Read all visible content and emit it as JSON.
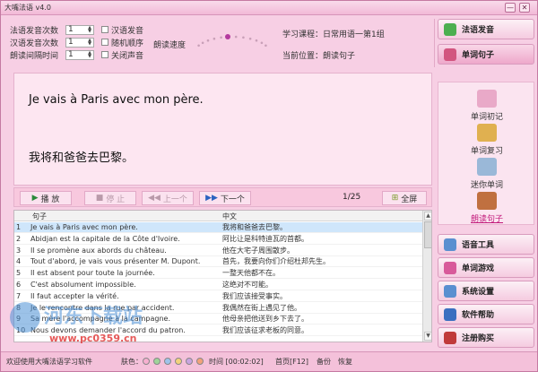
{
  "window": {
    "title": "大嘴法语 v4.0",
    "min": "—",
    "close": "✕"
  },
  "settings": {
    "spinners": [
      {
        "label": "法语发音次数",
        "value": "1"
      },
      {
        "label": "汉语发音次数",
        "value": "1"
      },
      {
        "label": "朗读间隔时间",
        "value": "1"
      }
    ],
    "checkboxes": [
      "汉语发音",
      "随机顺序",
      "关闭声音"
    ],
    "speed_label": "朗读速度",
    "speed_level": 0.45
  },
  "info": {
    "course": "学习课程：日常用语一第1组",
    "position": "当前位置：朗读句子"
  },
  "display": {
    "french": "Je vais à Paris avec mon père.",
    "chinese": "我将和爸爸去巴黎。"
  },
  "controls": {
    "play": "播 放",
    "stop": "停 止",
    "prev": "上一个",
    "next": "下一个",
    "page": "1/25",
    "fullscreen": "全屏"
  },
  "table": {
    "headers": [
      "句子",
      "中文"
    ],
    "rows": [
      {
        "n": "1",
        "fr": "Je vais à Paris avec mon père.",
        "cn": "我将和爸爸去巴黎。"
      },
      {
        "n": "2",
        "fr": "Abidjan est la capitale de la Côte d'Ivoire.",
        "cn": "阿比让是科特迪瓦的首都。"
      },
      {
        "n": "3",
        "fr": "Il se promène aux abords du château.",
        "cn": "他在大宅子周围散步。"
      },
      {
        "n": "4",
        "fr": "Tout d'abord, je vais vous présenter M. Dupont.",
        "cn": "首先，我要向你们介绍杜邦先生。"
      },
      {
        "n": "5",
        "fr": "Il est absent pour toute la journée.",
        "cn": "一整天他都不在。"
      },
      {
        "n": "6",
        "fr": "C'est absolument impossible.",
        "cn": "这绝对不可能。"
      },
      {
        "n": "7",
        "fr": "Il faut accepter la vérité.",
        "cn": "我们应该接受事实。"
      },
      {
        "n": "8",
        "fr": "Je le rencontre dans la rue par accident.",
        "cn": "我偶然在街上遇见了他。"
      },
      {
        "n": "9",
        "fr": "Sa mère l'accompagne à la campagne.",
        "cn": "他母亲把他送到乡下去了。"
      },
      {
        "n": "10",
        "fr": "Nous devons demander l'accord du patron.",
        "cn": "我们应该征求老板的同意。"
      }
    ]
  },
  "sidebar": {
    "main": [
      {
        "label": "法语发音",
        "color": "#4caf50"
      },
      {
        "label": "单词句子",
        "color": "#d2557f"
      }
    ],
    "sub": [
      {
        "label": "单词初记",
        "color": "#e9a9c8"
      },
      {
        "label": "单词复习",
        "color": "#e0b050"
      },
      {
        "label": "迷你单词",
        "color": "#9ab8d8"
      },
      {
        "label": "朗读句子",
        "color": "#c07040"
      }
    ],
    "tools": [
      {
        "label": "语音工具",
        "color": "#5a8fd0"
      },
      {
        "label": "单词游戏",
        "color": "#d85a9a"
      },
      {
        "label": "系统设置",
        "color": "#5a8fd0"
      },
      {
        "label": "软件帮助",
        "color": "#3a6fc0"
      },
      {
        "label": "注册购买",
        "color": "#c03a3a"
      }
    ]
  },
  "status": {
    "welcome": "欢迎使用大嘴法语学习软件",
    "skin": "肤色：",
    "skin_colors": [
      "#f7b0d0",
      "#9fd49a",
      "#9ec3ea",
      "#f2d27a",
      "#c9a4e0",
      "#f3a27a"
    ],
    "time": "时间 [00:02:02]",
    "home": "首页[F12]",
    "backup": "备份",
    "restore": "恢复"
  },
  "watermark": {
    "text": "河东下载站",
    "url": "www.pc0359.cn"
  }
}
